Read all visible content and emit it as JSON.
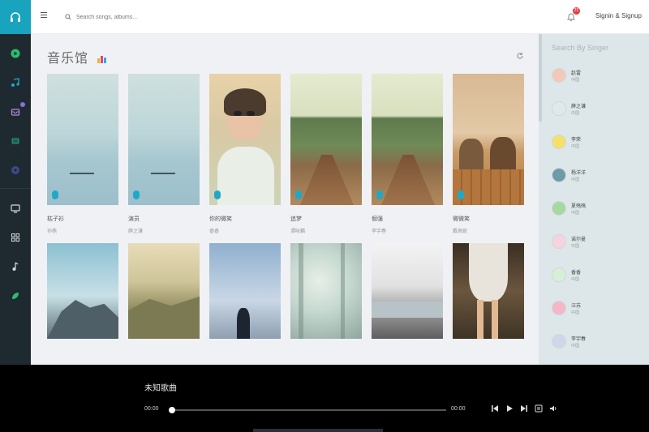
{
  "header": {
    "search_placeholder": "Search songs, albums...",
    "notification_count": "22",
    "signin_label": "Signin & Signup"
  },
  "leftnav": {
    "icons": [
      "headphones-icon",
      "play-circle-icon",
      "music-note-icon",
      "inbox-icon",
      "list-icon",
      "record-icon",
      "tv-icon",
      "grid-icon",
      "note-icon",
      "leaf-icon"
    ]
  },
  "main": {
    "title": "音乐馆",
    "cards_row1": [
      {
        "title": "枯子衫",
        "artist": "孙燕"
      },
      {
        "title": "演员",
        "artist": "薛之谦"
      },
      {
        "title": "你的微笑",
        "artist": "香香"
      },
      {
        "title": "追梦",
        "artist": "谭咏麟"
      },
      {
        "title": "倔强",
        "artist": "李宇春"
      },
      {
        "title": "微微笑",
        "artist": "戴佩妮"
      }
    ]
  },
  "sidebar": {
    "title": "Search By Singer",
    "singers": [
      {
        "name": "赵雷",
        "region": "中国"
      },
      {
        "name": "薛之谦",
        "region": "中国"
      },
      {
        "name": "李荣",
        "region": "中国"
      },
      {
        "name": "杨洋洋",
        "region": "中国"
      },
      {
        "name": "夏殇殇",
        "region": "中国"
      },
      {
        "name": "诺尔曼",
        "region": "中国"
      },
      {
        "name": "香香",
        "region": "中国"
      },
      {
        "name": "汪苏",
        "region": "中国"
      },
      {
        "name": "李宇春",
        "region": "中国"
      }
    ]
  },
  "player": {
    "song_title": "未知歌曲",
    "current_time": "00:00",
    "duration": "00:00",
    "progress": 0
  },
  "colors": {
    "accent": "#18a3bf",
    "nav_bg": "#1f2a30",
    "content_bg": "#f0f1f4",
    "sidebar_bg": "#dde7e9",
    "player_bg": "#000000",
    "badge_red": "#e83a3a"
  }
}
